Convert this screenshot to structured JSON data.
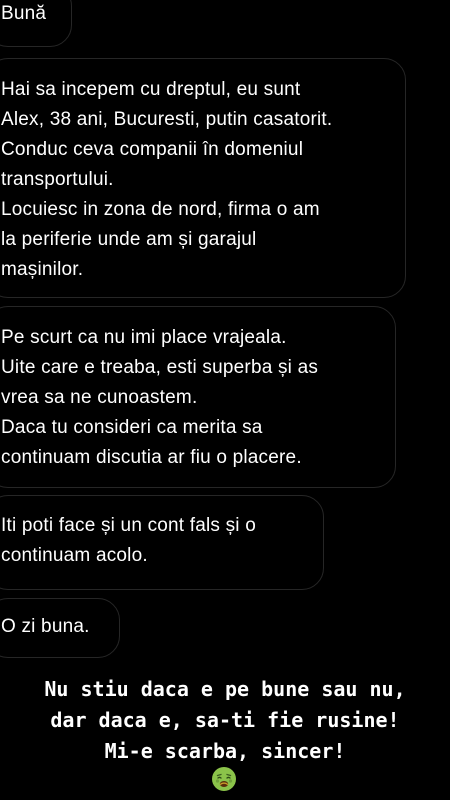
{
  "messages": [
    {
      "text": "Bună"
    },
    {
      "text": "Hai sa incepem cu dreptul, eu sunt\nAlex, 38 ani, Bucuresti, putin casatorit.\nConduc ceva companii în domeniul\ntransportului.\nLocuiesc in zona de nord,  firma o am\nla periferie unde am și garajul\nmașinilor."
    },
    {
      "text": "Pe scurt ca nu imi place vrajeala.\nUite care e treaba,  esti superba și as\nvrea sa ne cunoastem.\nDaca tu consideri ca merita sa\ncontinuam discutia ar fiu o placere."
    },
    {
      "text": "Iti poti face și un cont fals și o\ncontinuam acolo."
    },
    {
      "text": "O zi buna."
    }
  ],
  "caption": {
    "line1": "Nu stiu daca e pe bune sau nu,",
    "line2": "dar daca e, sa-ti fie rusine!",
    "line3": "Mi-e scarba, sincer!",
    "emoji": "nauseated-face"
  },
  "colors": {
    "background": "#000000",
    "bubble_border": "#262626",
    "text": "#ffffff",
    "emoji_face": "#8bc34a"
  }
}
